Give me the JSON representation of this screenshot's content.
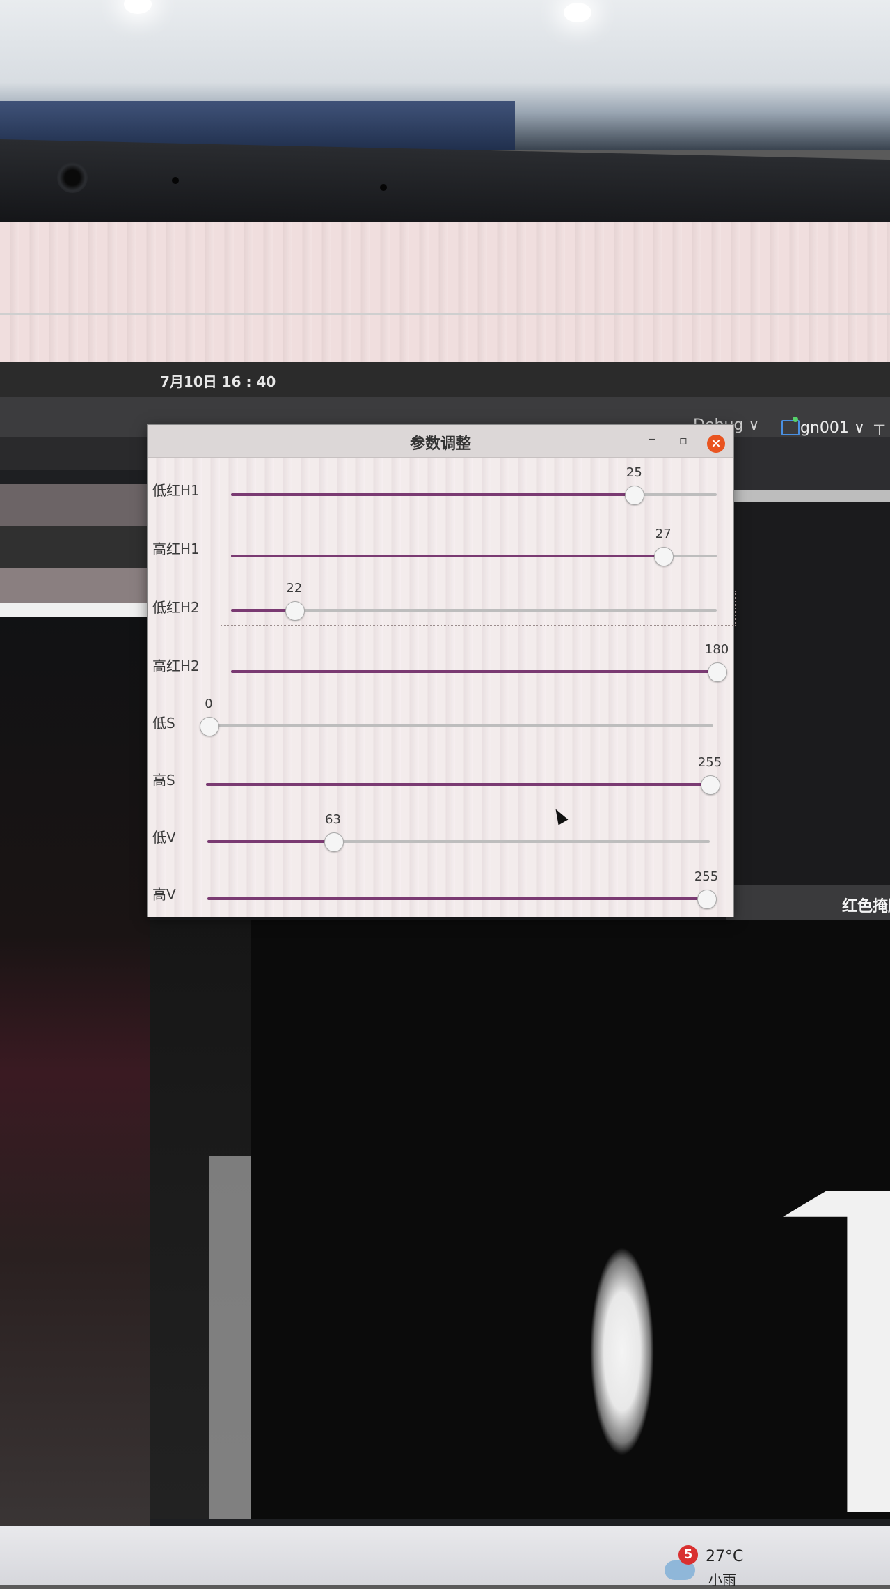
{
  "desktop": {
    "clock": "7月10日  16 : 40",
    "toolbar_text": "Debug ∨",
    "project_label": "gn001 ∨",
    "right_icon_glyph": "⊤"
  },
  "dialog": {
    "title": "参数调整",
    "minimize_glyph": "–",
    "maximize_glyph": "▫",
    "close_glyph": "×",
    "sliders": [
      {
        "label": "低红H1",
        "value": "25",
        "fraction": 0.83
      },
      {
        "label": "高红H1",
        "value": "27",
        "fraction": 0.89
      },
      {
        "label": "低红H2",
        "value": "22",
        "fraction": 0.13
      },
      {
        "label": "高红H2",
        "value": "180",
        "fraction": 1.0
      },
      {
        "label": "低S",
        "value": "0",
        "fraction": 0.0
      },
      {
        "label": "高S",
        "value": "255",
        "fraction": 1.0
      },
      {
        "label": "低V",
        "value": "63",
        "fraction": 0.25
      },
      {
        "label": "高V",
        "value": "255",
        "fraction": 1.0
      }
    ]
  },
  "mask_window": {
    "title": "红色掩膜"
  },
  "taskbar": {
    "weather_badge": "5",
    "temperature": "27°C",
    "weather_desc": "小雨"
  },
  "colors": {
    "accent": "#7a3a72",
    "close": "#e95420"
  }
}
